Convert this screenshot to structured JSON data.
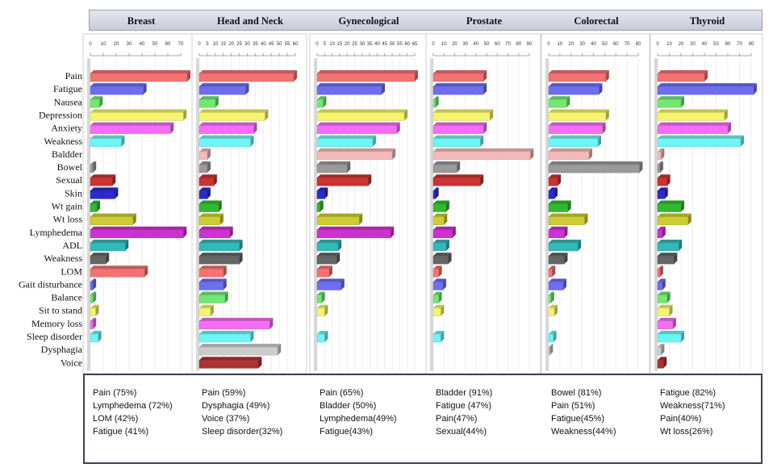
{
  "chart_data": {
    "type": "bar",
    "orientation": "horizontal",
    "style": "3d",
    "grid": true,
    "categories": [
      "Pain",
      "Fatigue",
      "Nausea",
      "Depression",
      "Anxiety",
      "Weakness",
      "Baldder",
      "Bowel",
      "Sexual",
      "Skin",
      "Wt gain",
      "Wt loss",
      "Lymphedema",
      "ADL",
      "Weakness",
      "LOM",
      "Gait disturbance",
      "Balance",
      "Sit to stand",
      "Memory loss",
      "Sleep disorder",
      "Dysphagia",
      "Voice"
    ],
    "colors": [
      "#f47272",
      "#6e6ef0",
      "#72e872",
      "#f4f46e",
      "#f46ef4",
      "#6ef4f4",
      "#f4baba",
      "#9a9a9a",
      "#cc3333",
      "#2b2bcc",
      "#33b833",
      "#cccc33",
      "#cc33cc",
      "#33b8b8",
      "#666666",
      "#f47272",
      "#6e6ef0",
      "#72e872",
      "#f4f46e",
      "#f46ef4",
      "#6ef4f4",
      "#cccccc",
      "#aa3333"
    ],
    "panels": [
      {
        "title": "Breast",
        "xlim": [
          0,
          70
        ],
        "ticks": [
          0,
          10,
          20,
          30,
          40,
          50,
          60,
          70
        ],
        "values": [
          75,
          41,
          7,
          72,
          62,
          24,
          0,
          2,
          17,
          19,
          5,
          33,
          72,
          27,
          12,
          42,
          2,
          2,
          4,
          2,
          6,
          0,
          0
        ],
        "notes": [
          "Pain (75%)",
          "Lymphedema (72%)",
          "LOM (42%)",
          "Fatigue (41%)"
        ]
      },
      {
        "title": "Head and Neck",
        "xlim": [
          0,
          60
        ],
        "ticks": [
          0,
          5,
          10,
          15,
          20,
          25,
          30,
          35,
          40,
          45,
          50,
          55,
          60
        ],
        "values": [
          59,
          29,
          10,
          41,
          34,
          32,
          5,
          5,
          9,
          5,
          12,
          13,
          19,
          25,
          25,
          15,
          15,
          16,
          7,
          44,
          32,
          49,
          37
        ],
        "notes": [
          "Pain (59%)",
          "Dysphagia (49%)",
          "Voice (37%)",
          "Sleep disorder(32%)"
        ]
      },
      {
        "title": "Gynecological",
        "xlim": [
          0,
          65
        ],
        "ticks": [
          0,
          5,
          10,
          15,
          20,
          25,
          30,
          35,
          40,
          45,
          50,
          55,
          60,
          65
        ],
        "values": [
          65,
          43,
          4,
          58,
          53,
          37,
          50,
          20,
          34,
          5,
          2,
          28,
          49,
          14,
          13,
          8,
          16,
          3,
          5,
          0,
          5,
          0,
          0
        ],
        "notes": [
          "Pain (65%)",
          "Bladder (50%)",
          "Lymphedema(49%)",
          "Fatigue(43%)"
        ]
      },
      {
        "title": "Prostate",
        "xlim": [
          0,
          90
        ],
        "ticks": [
          0,
          10,
          20,
          30,
          40,
          50,
          60,
          70,
          80,
          90
        ],
        "values": [
          47,
          47,
          2,
          53,
          47,
          44,
          91,
          22,
          44,
          2,
          12,
          10,
          18,
          12,
          14,
          5,
          9,
          5,
          7,
          0,
          7,
          0,
          0
        ],
        "notes": [
          "Bladder (91%)",
          "Fatigue (47%)",
          "Pain(47%)",
          "Sexual(44%)"
        ]
      },
      {
        "title": "Colorectal",
        "xlim": [
          0,
          80
        ],
        "ticks": [
          0,
          10,
          20,
          30,
          40,
          50,
          60,
          70,
          80
        ],
        "values": [
          51,
          45,
          16,
          51,
          48,
          44,
          36,
          81,
          8,
          5,
          17,
          32,
          14,
          26,
          14,
          3,
          13,
          2,
          5,
          0,
          4,
          1,
          0
        ],
        "notes": [
          "Bowel (81%)",
          "Pain (51%)",
          "Fatigue(45%)",
          "Weakness(44%)"
        ]
      },
      {
        "title": "Thyroid",
        "xlim": [
          0,
          80
        ],
        "ticks": [
          0,
          10,
          20,
          30,
          40,
          50,
          60,
          70,
          80
        ],
        "values": [
          40,
          82,
          20,
          57,
          60,
          71,
          3,
          2,
          8,
          6,
          20,
          26,
          4,
          18,
          14,
          2,
          4,
          8,
          10,
          13,
          20,
          3,
          5
        ],
        "notes": [
          "Fatigue (82%)",
          "Weakness(71%)",
          "Pain(40%)",
          "Wt loss(26%)"
        ]
      }
    ]
  }
}
